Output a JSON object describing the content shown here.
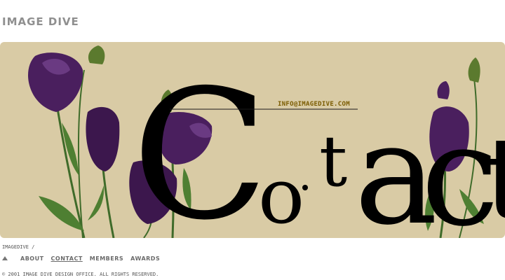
{
  "site": {
    "logo_text": "IMAGE DIVE"
  },
  "hero": {
    "email_link": "INFO@IMAGEDIVE.COM",
    "background_color": "#d9cba5",
    "decorative_word": "Contact",
    "flower_color": "#4a1f5e"
  },
  "footer": {
    "breadcrumb": "IMAGEDIVE /",
    "nav": [
      {
        "label": "ABOUT"
      },
      {
        "label": "CONTACT",
        "active": true
      },
      {
        "label": "MEMBERS"
      },
      {
        "label": "AWARDS"
      }
    ],
    "copyright": "© 2001 IMAGE DIVE DESIGN OFFICE. ALL RIGHTS RESERVED."
  }
}
